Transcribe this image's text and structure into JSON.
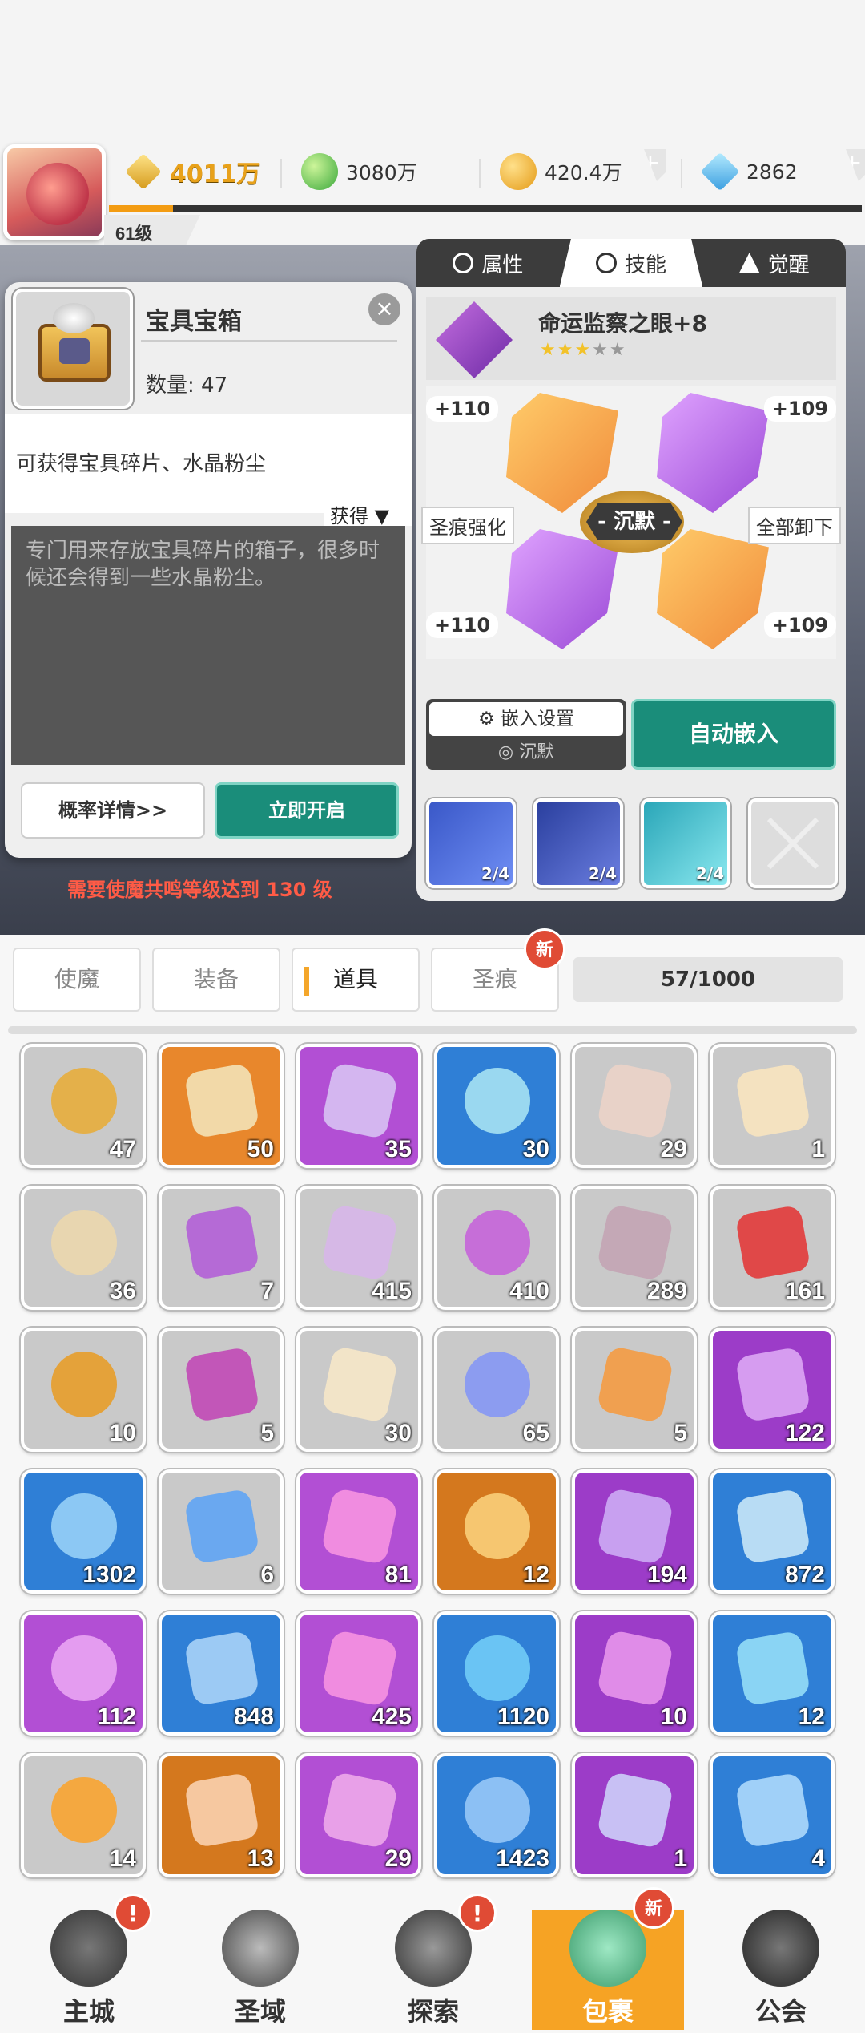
{
  "header": {
    "level": "61级",
    "power": "4011万",
    "green_currency": "3080万",
    "gold": "420.4万",
    "crystal": "2862",
    "plus": "+"
  },
  "popup": {
    "title": "宝具宝箱",
    "quantity": "数量: 47",
    "source": "可获得宝具碎片、水晶粉尘",
    "obtain_label": "获得 ▼",
    "description": "专门用来存放宝具碎片的箱子，很多时候还会得到一些水晶粉尘。",
    "prob_button": "概率详情>>",
    "open_button": "立即开启",
    "close": "×"
  },
  "warning": "需要使魔共鸣等级达到 130 级",
  "panel": {
    "tabs": [
      {
        "label": "属性",
        "icon": "attribute-icon"
      },
      {
        "label": "技能",
        "icon": "skill-icon"
      },
      {
        "label": "觉醒",
        "icon": "awaken-icon"
      }
    ],
    "skill_name": "命运监察之眼+8",
    "stars_on": "★★★",
    "stars_off": "★★",
    "values": [
      "+110",
      "+109",
      "+110",
      "+109"
    ],
    "center_label": "- 沉默 -",
    "left_label": "圣痕强化",
    "right_label": "全部卸下",
    "embed_settings": "嵌入设置",
    "embed_mode": "沉默",
    "auto_embed": "自动嵌入",
    "slots": [
      "2/4",
      "2/4",
      "2/4"
    ]
  },
  "inventory": {
    "tabs": [
      "使魔",
      "装备",
      "道具",
      "圣痕"
    ],
    "new_badge": "新",
    "capacity": "57/1000",
    "items": [
      {
        "count": "47",
        "bg": "#c9c9c9",
        "color": "#e4b04a"
      },
      {
        "count": "50",
        "bg": "#e8872c",
        "color": "#f2d9a8"
      },
      {
        "count": "35",
        "bg": "#b24fd4",
        "color": "#d4b6f0"
      },
      {
        "count": "30",
        "bg": "#2f7fd6",
        "color": "#9ad8f0"
      },
      {
        "count": "29",
        "bg": "#c9c9c9",
        "color": "#e8d2c8"
      },
      {
        "count": "1",
        "bg": "#c9c9c9",
        "color": "#f4e2c0"
      },
      {
        "count": "36",
        "bg": "#c9c9c9",
        "color": "#e8d6b0"
      },
      {
        "count": "7",
        "bg": "#c9c9c9",
        "color": "#b56ad6"
      },
      {
        "count": "415",
        "bg": "#c9c9c9",
        "color": "#d6b8e6"
      },
      {
        "count": "410",
        "bg": "#c9c9c9",
        "color": "#c66ed8"
      },
      {
        "count": "289",
        "bg": "#c9c9c9",
        "color": "#c4a8b6"
      },
      {
        "count": "161",
        "bg": "#c9c9c9",
        "color": "#e04848"
      },
      {
        "count": "10",
        "bg": "#c9c9c9",
        "color": "#e4a23a"
      },
      {
        "count": "5",
        "bg": "#c9c9c9",
        "color": "#c256b8"
      },
      {
        "count": "30",
        "bg": "#c9c9c9",
        "color": "#f2e4c8"
      },
      {
        "count": "65",
        "bg": "#c9c9c9",
        "color": "#8c9cf0"
      },
      {
        "count": "5",
        "bg": "#c9c9c9",
        "color": "#f0a050"
      },
      {
        "count": "122",
        "bg": "#9c3cc8",
        "color": "#d69cf0"
      },
      {
        "count": "1302",
        "bg": "#2f7fd6",
        "color": "#8cc8f4"
      },
      {
        "count": "6",
        "bg": "#c9c9c9",
        "color": "#6aa8f0"
      },
      {
        "count": "81",
        "bg": "#b24fd4",
        "color": "#f08ce0"
      },
      {
        "count": "12",
        "bg": "#d4781e",
        "color": "#f6c670"
      },
      {
        "count": "194",
        "bg": "#9c3cc8",
        "color": "#c8a0f0"
      },
      {
        "count": "872",
        "bg": "#2f7fd6",
        "color": "#b8dcf4"
      },
      {
        "count": "112",
        "bg": "#b24fd4",
        "color": "#e49cf0"
      },
      {
        "count": "848",
        "bg": "#2f7fd6",
        "color": "#9ccaf4"
      },
      {
        "count": "425",
        "bg": "#b24fd4",
        "color": "#f08ce0"
      },
      {
        "count": "1120",
        "bg": "#2f7fd6",
        "color": "#6ac4f4"
      },
      {
        "count": "10",
        "bg": "#9c3cc8",
        "color": "#e08ce8"
      },
      {
        "count": "12",
        "bg": "#2f7fd6",
        "color": "#8ad4f4"
      },
      {
        "count": "14",
        "bg": "#c9c9c9",
        "color": "#f4a840"
      },
      {
        "count": "13",
        "bg": "#d4781e",
        "color": "#f6c8a0"
      },
      {
        "count": "29",
        "bg": "#b24fd4",
        "color": "#e8a0e8"
      },
      {
        "count": "1423",
        "bg": "#2f7fd6",
        "color": "#8cc0f4"
      },
      {
        "count": "1",
        "bg": "#9c3cc8",
        "color": "#c8c0f4"
      },
      {
        "count": "4",
        "bg": "#2f7fd6",
        "color": "#a0d0f8"
      }
    ]
  },
  "nav": {
    "items": [
      "主城",
      "圣域",
      "探索",
      "包裹",
      "公会"
    ],
    "alert": "!",
    "new": "新"
  }
}
